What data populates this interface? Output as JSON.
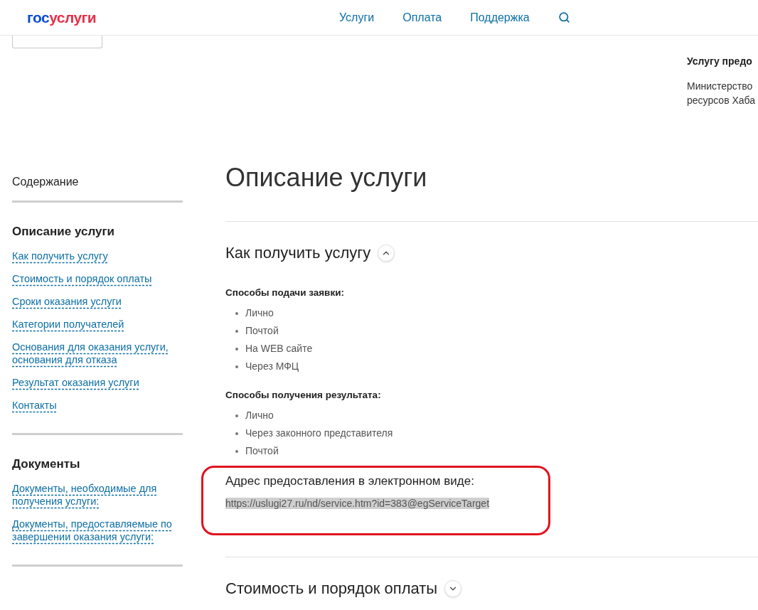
{
  "header": {
    "logo": {
      "first": "гос",
      "second": "услуги"
    },
    "nav": [
      "Услуги",
      "Оплата",
      "Поддержка"
    ]
  },
  "provider": {
    "title": "Услугу предо",
    "lines": [
      "Министерство",
      "ресурсов Хаба"
    ]
  },
  "sidebar": {
    "title": "Содержание",
    "sections": [
      {
        "heading": "Описание услуги",
        "links": [
          "Как получить услугу",
          "Стоимость и порядок оплаты",
          "Сроки оказания услуги",
          "Категории получателей",
          "Основания для оказания услуги, основания для отказа",
          "Результат оказания услуги",
          "Контакты"
        ]
      },
      {
        "heading": "Документы",
        "links": [
          "Документы, необходимые для получения услуги:",
          "Документы, предоставляемые по завершении оказания услуги:"
        ]
      }
    ]
  },
  "main": {
    "title": "Описание услуги",
    "sections": [
      {
        "heading": "Как получить услугу",
        "expanded": true,
        "groups": [
          {
            "heading": "Способы подачи заявки:",
            "items": [
              "Лично",
              "Почтой",
              "На WEB сайте",
              "Через МФЦ"
            ]
          },
          {
            "heading": "Способы получения результата:",
            "items": [
              "Лично",
              "Через законного представителя",
              "Почтой"
            ]
          }
        ],
        "address": {
          "label": "Адрес предоставления в электронном виде:",
          "url": "https://uslugi27.ru/nd/service.htm?id=383@egServiceTarget"
        }
      },
      {
        "heading": "Стоимость и порядок оплаты",
        "expanded": false
      }
    ]
  }
}
